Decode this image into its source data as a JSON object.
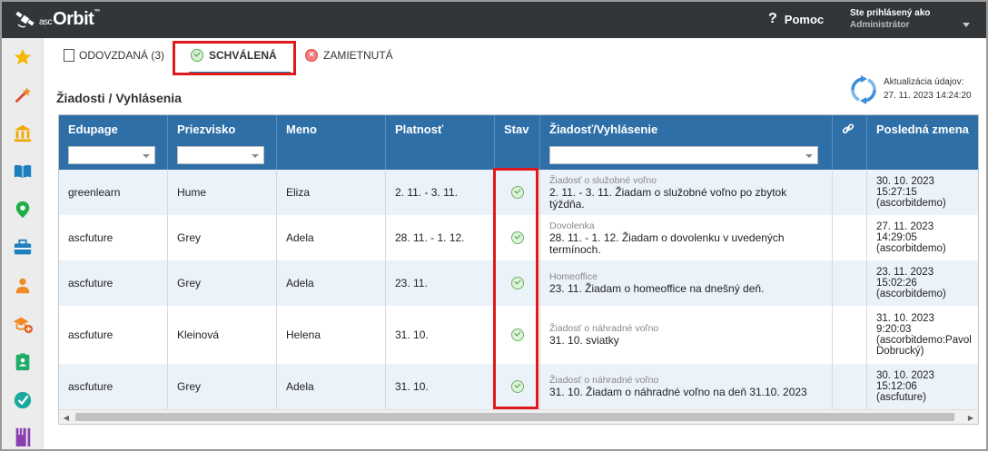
{
  "app": {
    "logo_prefix": "asc",
    "logo_name": "Orbit",
    "logo_tm": "™"
  },
  "header": {
    "help_label": "Pomoc",
    "user_line1": "Ste prihlásený ako",
    "user_line2": "Administrátor"
  },
  "sidebar": {
    "items": [
      "star-icon",
      "magic-wand-icon",
      "bank-icon",
      "book-icon",
      "location-pin-icon",
      "briefcase-icon",
      "person-icon",
      "teacher-add-icon",
      "clipboard-person-icon",
      "check-circle-icon",
      "fork-knife-icon"
    ]
  },
  "tabs": [
    {
      "label": "ODOVZDANÁ (3)",
      "icon": "document-icon",
      "active": false
    },
    {
      "label": "SCHVÁLENÁ",
      "icon": "check-circle-icon",
      "active": true
    },
    {
      "label": "ZAMIETNUTÁ",
      "icon": "x-circle-icon",
      "active": false
    }
  ],
  "page_title": "Žiadosti / Vyhlásenia",
  "update": {
    "label": "Aktualizácia údajov:",
    "value": "27. 11. 2023 14:24:20"
  },
  "table": {
    "columns": [
      "Edupage",
      "Priezvisko",
      "Meno",
      "Platnosť",
      "Stav",
      "Žiadosť/Vyhlásenie",
      "",
      "Posledná zmena"
    ],
    "rows": [
      {
        "edupage": "greenlearn",
        "priezvisko": "Hume",
        "meno": "Eliza",
        "platnost": "2. 11. - 3. 11.",
        "stav": "schválená",
        "req_type": "Žiadosť o služobné voľno",
        "req_text1": "2. 11. - 3. 11. Žiadam o služobné voľno po zbytok",
        "req_text2": "týždňa.",
        "chg1": "30. 10. 2023",
        "chg2": "15:27:15",
        "chg3": "(ascorbitdemo)"
      },
      {
        "edupage": "ascfuture",
        "priezvisko": "Grey",
        "meno": "Adela",
        "platnost": "28. 11. - 1. 12.",
        "stav": "schválená",
        "req_type": "Dovolenka",
        "req_text1": "28. 11. - 1. 12. Žiadam o dovolenku v uvedených",
        "req_text2": "termínoch.",
        "chg1": "27. 11. 2023",
        "chg2": "14:29:05",
        "chg3": "(ascorbitdemo)"
      },
      {
        "edupage": "ascfuture",
        "priezvisko": "Grey",
        "meno": "Adela",
        "platnost": "23. 11.",
        "stav": "schválená",
        "req_type": "Homeoffice",
        "req_text1": "23. 11. Žiadam o homeoffice na dnešný deň.",
        "req_text2": "",
        "chg1": "23. 11. 2023",
        "chg2": "15:02:26",
        "chg3": "(ascorbitdemo)"
      },
      {
        "edupage": "ascfuture",
        "priezvisko": "Kleinová",
        "meno": "Helena",
        "platnost": "31. 10.",
        "stav": "schválená",
        "req_type": "Žiadosť o náhradné voľno",
        "req_text1": "31. 10. sviatky",
        "req_text2": "",
        "chg1": "31. 10. 2023",
        "chg2": "9:20:03",
        "chg3": "(ascorbitdemo:Pavol",
        "chg4": "Dobrucký)"
      },
      {
        "edupage": "ascfuture",
        "priezvisko": "Grey",
        "meno": "Adela",
        "platnost": "31. 10.",
        "stav": "schválená",
        "req_type": "Žiadosť o náhradné voľno",
        "req_text1": "31. 10. Žiadam o náhradné voľno na deň 31.10. 2023",
        "req_text2": "",
        "chg1": "30. 10. 2023",
        "chg2": "15:12:06",
        "chg3": "(ascfuture)"
      }
    ]
  },
  "colors": {
    "header_bg": "#2f6fa7",
    "topbar_bg": "#323639",
    "highlight": "#e01a1a",
    "accent": "#2d78b8"
  }
}
